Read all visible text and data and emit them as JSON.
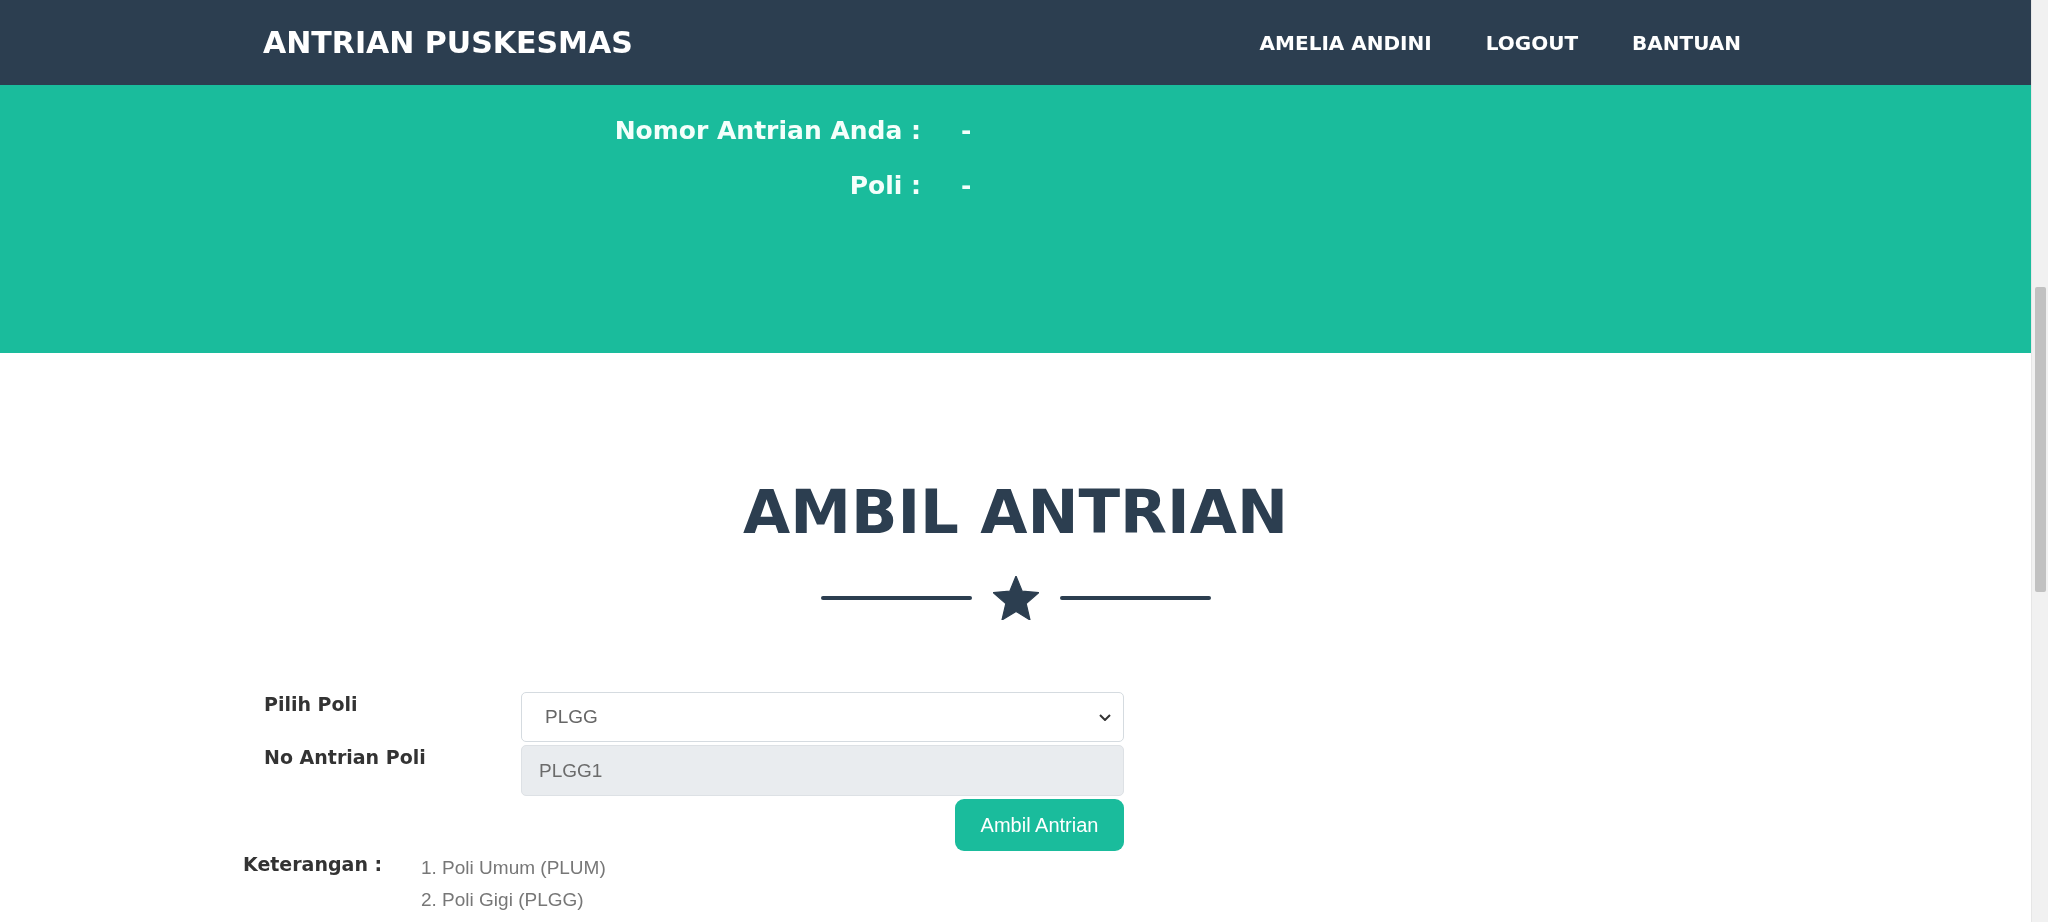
{
  "navbar": {
    "brand": "ANTRIAN PUSKESMAS",
    "links": [
      "AMELIA ANDINI",
      "LOGOUT",
      "BANTUAN"
    ]
  },
  "queue_info": [
    {
      "label": "Nomor Antrian Anda :",
      "value": "-"
    },
    {
      "label": "Poli :",
      "value": "-"
    }
  ],
  "section": {
    "title": "AMBIL ANTRIAN"
  },
  "form": {
    "fields": [
      {
        "kind": "select",
        "label": "Pilih Poli",
        "value": "PLGG"
      },
      {
        "kind": "readonly",
        "label": "No Antrian Poli",
        "value": "PLGG1"
      }
    ],
    "submit": "Ambil Antrian"
  },
  "notes": {
    "label": "Keterangan :",
    "items": [
      "1. Poli Umum (PLUM)",
      "2. Poli Gigi (PLGG)"
    ]
  }
}
